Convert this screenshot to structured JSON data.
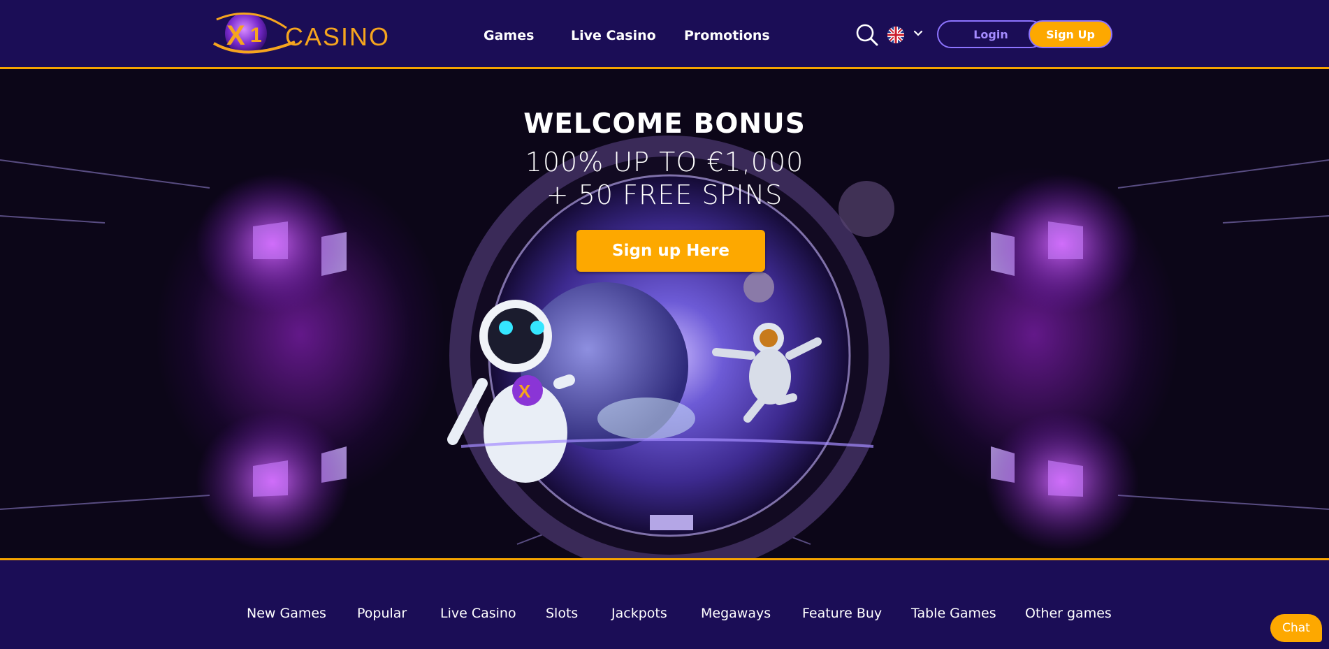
{
  "brand": {
    "logo_text": "CASINO",
    "accent": "#f5a300",
    "primary_bg": "#1b0d56"
  },
  "header": {
    "nav": [
      "Games",
      "Live Casino",
      "Promotions"
    ],
    "search_icon": "search-icon",
    "language_icon": "uk-flag-icon",
    "login_label": "Login",
    "signup_label": "Sign Up"
  },
  "hero": {
    "title": "WELCOME BONUS",
    "line1": "100% UP TO  €1,000",
    "line2": "+ 50 FREE SPINS",
    "cta_label": "Sign up Here"
  },
  "categories": [
    "New Games",
    "Popular",
    "Live Casino",
    "Slots",
    "Jackpots",
    "Megaways",
    "Feature Buy",
    "Table Games",
    "Other games"
  ],
  "chat": {
    "label": "Chat"
  }
}
